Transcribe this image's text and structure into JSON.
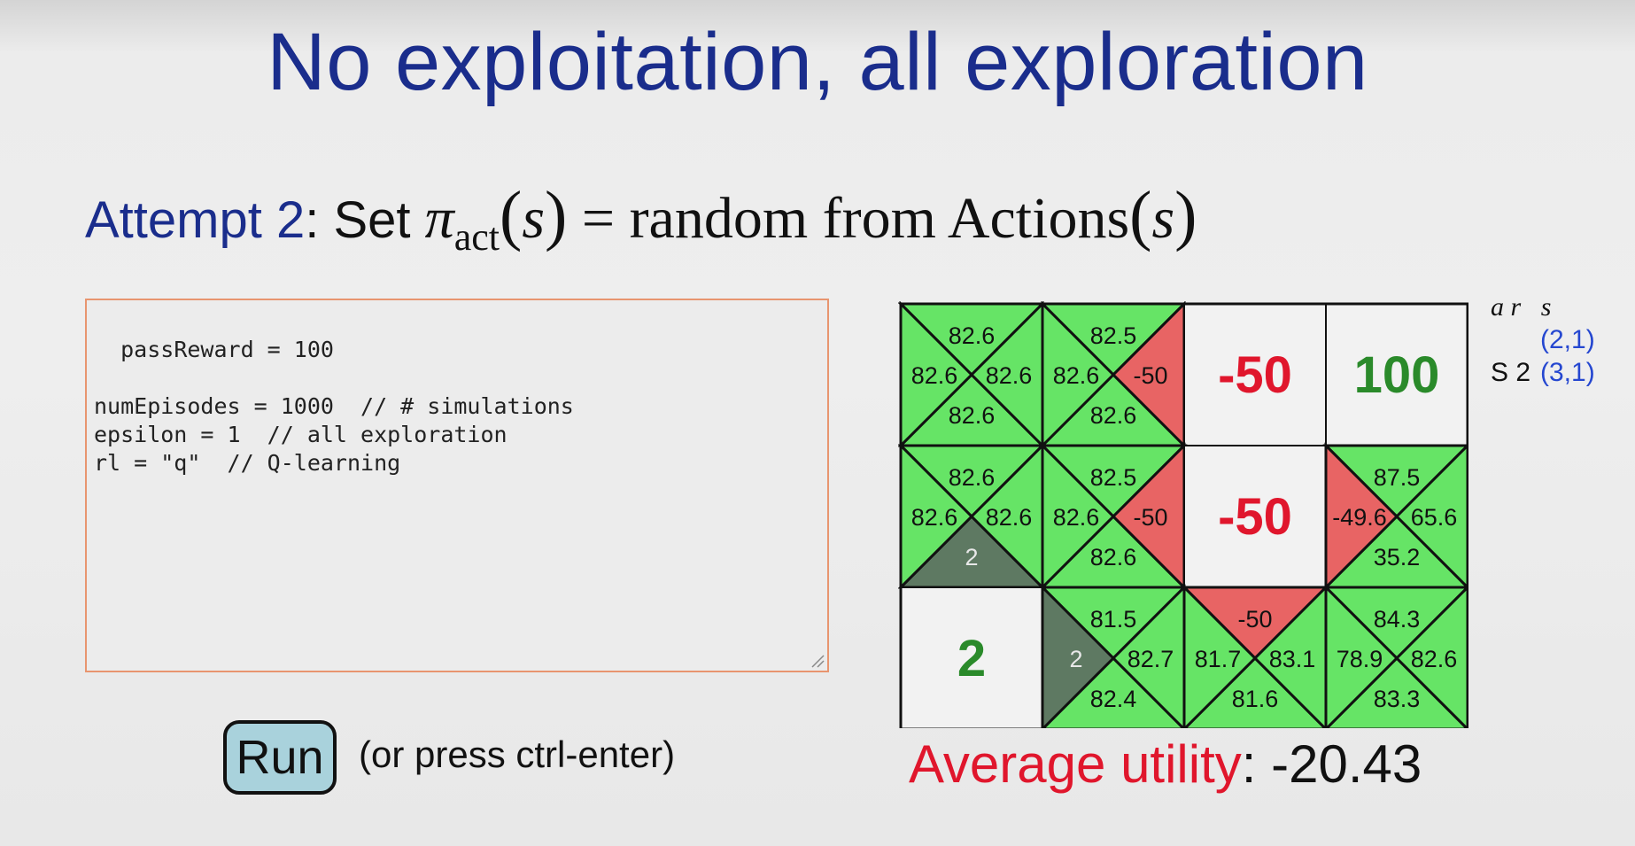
{
  "slide": {
    "title": "No exploitation, all exploration",
    "attempt_label": "Attempt 2",
    "attempt_text": ": Set",
    "formula_pi": "π",
    "formula_sub": "act",
    "formula_s": "s",
    "formula_eq": " = random from Actions",
    "formula_s2": "s"
  },
  "editor": {
    "code": "passReward = 100\n\nnumEpisodes = 1000  // # simulations\nepsilon = 1  // all exploration\nrl = \"q\"  // Q-learning"
  },
  "controls": {
    "run_label": "Run",
    "hint": "(or press ctrl-enter)"
  },
  "legend": {
    "ar": "a r",
    "s": "s",
    "coord1": "(2,1)",
    "prefix2": "S 2",
    "coord2": "(3,1)"
  },
  "utility": {
    "label": "Average utility",
    "value": ": -20.43"
  },
  "colors": {
    "green": "#66e466",
    "red": "#e86464",
    "gray": "#5e7962",
    "negative_text": "#e0162c",
    "positive_text": "#2a8a2a"
  },
  "grid": {
    "cells": [
      {
        "row": 0,
        "col": 0,
        "type": "q",
        "top": "82.6",
        "left": "82.6",
        "right": "82.6",
        "bottom": "82.6",
        "colors": {
          "top": "green",
          "left": "green",
          "right": "green",
          "bottom": "green"
        }
      },
      {
        "row": 0,
        "col": 1,
        "type": "q",
        "top": "82.5",
        "left": "82.6",
        "right": "-50",
        "bottom": "82.6",
        "colors": {
          "top": "green",
          "left": "green",
          "right": "red",
          "bottom": "green"
        }
      },
      {
        "row": 0,
        "col": 2,
        "type": "value",
        "value": "-50",
        "tone": "negative"
      },
      {
        "row": 0,
        "col": 3,
        "type": "value",
        "value": "100",
        "tone": "positive"
      },
      {
        "row": 1,
        "col": 0,
        "type": "q",
        "top": "82.6",
        "left": "82.6",
        "right": "82.6",
        "bottom": "2",
        "colors": {
          "top": "green",
          "left": "green",
          "right": "green",
          "bottom": "gray"
        }
      },
      {
        "row": 1,
        "col": 1,
        "type": "q",
        "top": "82.5",
        "left": "82.6",
        "right": "-50",
        "bottom": "82.6",
        "colors": {
          "top": "green",
          "left": "green",
          "right": "red",
          "bottom": "green"
        }
      },
      {
        "row": 1,
        "col": 2,
        "type": "value",
        "value": "-50",
        "tone": "negative"
      },
      {
        "row": 1,
        "col": 3,
        "type": "q",
        "top": "87.5",
        "left": "-49.6",
        "right": "65.6",
        "bottom": "35.2",
        "colors": {
          "top": "green",
          "left": "red",
          "right": "green",
          "bottom": "green"
        }
      },
      {
        "row": 2,
        "col": 0,
        "type": "value",
        "value": "2",
        "tone": "positive"
      },
      {
        "row": 2,
        "col": 1,
        "type": "q",
        "top": "81.5",
        "left": "2",
        "right": "82.7",
        "bottom": "82.4",
        "colors": {
          "top": "green",
          "left": "gray",
          "right": "green",
          "bottom": "green"
        }
      },
      {
        "row": 2,
        "col": 2,
        "type": "q",
        "top": "-50",
        "left": "81.7",
        "right": "83.1",
        "bottom": "81.6",
        "colors": {
          "top": "red",
          "left": "green",
          "right": "green",
          "bottom": "green"
        }
      },
      {
        "row": 2,
        "col": 3,
        "type": "q",
        "top": "84.3",
        "left": "78.9",
        "right": "82.6",
        "bottom": "83.3",
        "colors": {
          "top": "green",
          "left": "green",
          "right": "green",
          "bottom": "green"
        }
      }
    ]
  }
}
